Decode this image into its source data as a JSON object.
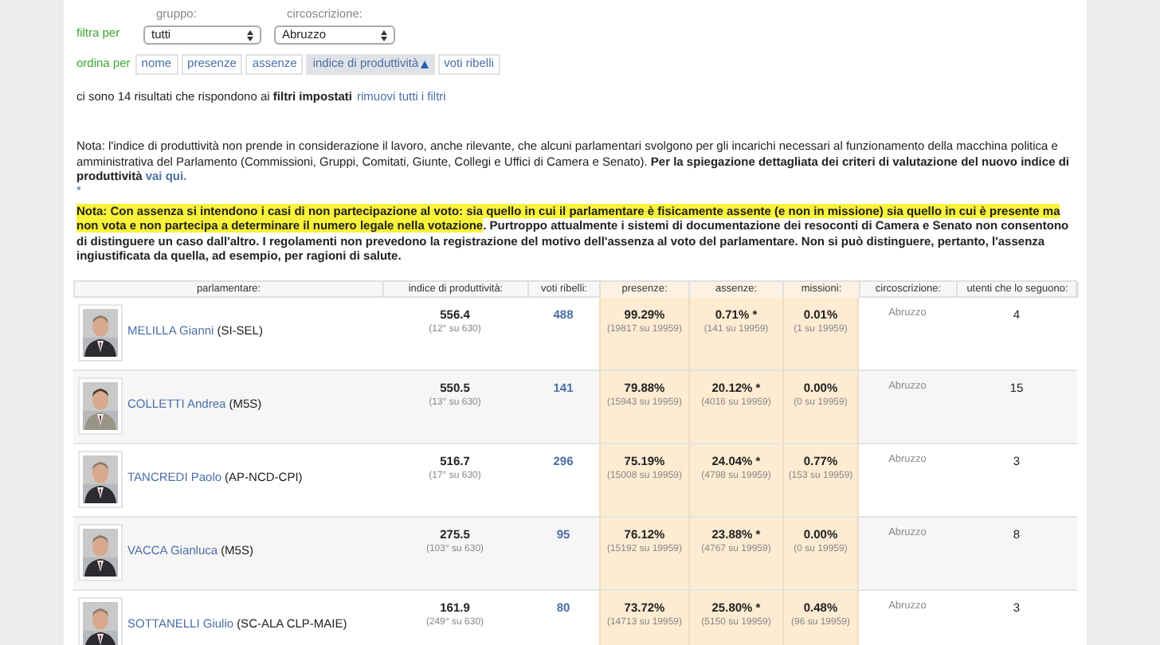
{
  "filters": {
    "label": "filtra per",
    "fields": [
      {
        "label": "gruppo:",
        "value": "tutti"
      },
      {
        "label": "circoscrizione:",
        "value": "Abruzzo"
      }
    ]
  },
  "sort": {
    "label": "ordina per",
    "options": [
      {
        "label": "nome",
        "selected": false
      },
      {
        "label": "presenze",
        "selected": false
      },
      {
        "label": "assenze",
        "selected": false
      },
      {
        "label": "indice di produttività",
        "selected": true
      },
      {
        "label": "voti ribelli",
        "selected": false
      }
    ]
  },
  "results": {
    "text": "ci sono 14 risultati che rispondono ai **filtri impostati**",
    "link": "rimuovi tutti i filtri"
  },
  "note": {
    "text": "Nota: l'indice di produttività non prende in considerazione il lavoro, anche rilevante, che alcuni parlamentari svolgono per gli incarichi necessari al funzionamento della macchina politica e amministrativa del Parlamento (Commissioni, Gruppi, Comitati, Giunte, Collegi e Uffici di Camera e Senato). **Per la spiegazione dettagliata dei criteri di valutazione del nuovo indice di produttività**",
    "link": "vai qui."
  },
  "asterisk": "*",
  "note2": {
    "highlighted": "Nota: Con assenza si intendono i casi di non partecipazione al voto: sia quello in cui il parlamentare è fisicamente assente (e non in missione) sia quello in cui è presente ma non vota e non partecipa a determinare il numero legale nella votazione",
    "rest": ". Purtroppo attualmente i sistemi di documentazione dei resoconti di Camera e Senato non consentono di distinguere un caso dall'altro. I regolamenti non prevedono la registrazione del motivo dell'assenza al voto del parlamentare. Non si può distinguere, pertanto, l'assenza ingiustificata da quella, ad esempio, per ragioni di salute."
  },
  "table": {
    "columns": [
      "parlamentare:",
      "indice di produttività:",
      "voti ribelli:",
      "presenze:",
      "assenze:",
      "missioni:",
      "circoscrizione:",
      "utenti che lo seguono:"
    ],
    "rows": [
      {
        "name": "MELILLA Gianni",
        "group": "(SI-SEL)",
        "index": "556.4",
        "rank": "(12° su 630)",
        "rebel": "488",
        "presence": "99.29%",
        "presence_detail": "(19817 su 19959)",
        "absence": "0.71% *",
        "absence_detail": "(141 su 19959)",
        "mission": "0.01%",
        "mission_detail": "(1 su 19959)",
        "district": "Abruzzo",
        "followers": "4"
      },
      {
        "name": "COLLETTI Andrea",
        "group": "(M5S)",
        "index": "550.5",
        "rank": "(13° su 630)",
        "rebel": "141",
        "presence": "79.88%",
        "presence_detail": "(15943 su 19959)",
        "absence": "20.12% *",
        "absence_detail": "(4016 su 19959)",
        "mission": "0.00%",
        "mission_detail": "(0 su 19959)",
        "district": "Abruzzo",
        "followers": "15"
      },
      {
        "name": "TANCREDI Paolo",
        "group": "(AP-NCD-CPI)",
        "index": "516.7",
        "rank": "(17° su 630)",
        "rebel": "296",
        "presence": "75.19%",
        "presence_detail": "(15008 su 19959)",
        "absence": "24.04% *",
        "absence_detail": "(4798 su 19959)",
        "mission": "0.77%",
        "mission_detail": "(153 su 19959)",
        "district": "Abruzzo",
        "followers": "3"
      },
      {
        "name": "VACCA Gianluca",
        "group": "(M5S)",
        "index": "275.5",
        "rank": "(103° su 630)",
        "rebel": "95",
        "presence": "76.12%",
        "presence_detail": "(15192 su 19959)",
        "absence": "23.88% *",
        "absence_detail": "(4767 su 19959)",
        "mission": "0.00%",
        "mission_detail": "(0 su 19959)",
        "district": "Abruzzo",
        "followers": "8"
      },
      {
        "name": "SOTTANELLI Giulio",
        "group": "(SC-ALA CLP-MAIE)",
        "index": "161.9",
        "rank": "(249° su 630)",
        "rebel": "80",
        "presence": "73.72%",
        "presence_detail": "(14713 su 19959)",
        "absence": "25.80% *",
        "absence_detail": "(5150 su 19959)",
        "mission": "0.48%",
        "mission_detail": "(96 su 19959)",
        "district": "Abruzzo",
        "followers": "3"
      }
    ]
  }
}
